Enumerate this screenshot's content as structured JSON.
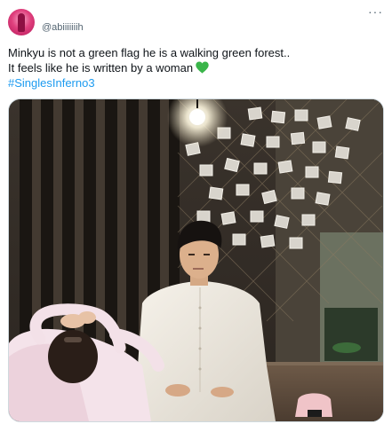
{
  "tweet": {
    "handle": "@abiiiiiiih",
    "more_label": "···",
    "text_lines": [
      "Minkyu is not a green flag he is a walking green forest..",
      "It feels like he is written by a woman"
    ],
    "hashtag": "#SinglesInferno3"
  },
  "media": {
    "icon": "video-still-image"
  },
  "colors": {
    "link": "#1d9bf0",
    "secondary_text": "#536471",
    "heart": "#3ab54a"
  }
}
